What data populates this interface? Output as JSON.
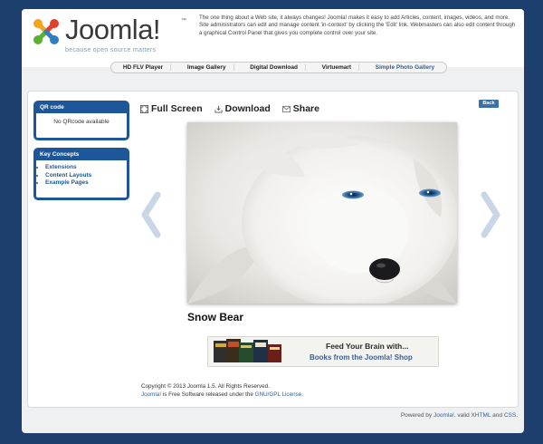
{
  "header": {
    "logo_text": "Joomla!",
    "logo_tm": "™",
    "logo_tagline": "because open source matters",
    "intro_text": "The one thing about a Web site, it always changes! Joomla! makes it easy to add Articles, content, images, videos, and more. Site administrators can edit and manage content 'in-context' by clicking the 'Edit' link. Webmasters can also edit content through a graphical Control Panel that gives you complete control over your site."
  },
  "nav": {
    "items": [
      {
        "label": "HD FLV Player"
      },
      {
        "label": "Image Gallery"
      },
      {
        "label": "Digital Download"
      },
      {
        "label": "Virtuemart"
      },
      {
        "label": "Simple Photo Gallery"
      }
    ],
    "active": "Simple Photo Gallery"
  },
  "sidebar": {
    "qr": {
      "title": "QR code",
      "body": "No QRcode available"
    },
    "key_concepts": {
      "title": "Key Concepts",
      "links": [
        {
          "label": "Extensions"
        },
        {
          "label": "Content Layouts"
        },
        {
          "label": "Example Pages"
        }
      ]
    }
  },
  "toolbar": {
    "fullscreen_label": "Full Screen",
    "download_label": "Download",
    "share_label": "Share"
  },
  "back_label": "Back",
  "gallery": {
    "caption": "Snow Bear"
  },
  "banner": {
    "line1": "Feed Your Brain with...",
    "line2": "Books from the Joomla! Shop"
  },
  "copyright": {
    "line1": "Copyright © 2013 Joomla 1.5. All Rights Reserved.",
    "joomla_link": "Joomla!",
    "line2_middle": " is Free Software released under the ",
    "license_link": "GNU/GPL License",
    "line2_end": "."
  },
  "footer": {
    "prefix": "Powered by ",
    "joomla_link": "Joomla!",
    "middle": ". valid ",
    "xhtml_link": "XHTML",
    "and": " and ",
    "css_link": "CSS",
    "end": "."
  },
  "colors": {
    "background": "#1d3f6e",
    "module_blue": "#1e5799",
    "link": "#2d5fa0"
  },
  "icons": [
    "joomla-logo-icon",
    "fullscreen-icon",
    "download-icon",
    "share-icon",
    "chevron-left-icon",
    "chevron-right-icon"
  ]
}
